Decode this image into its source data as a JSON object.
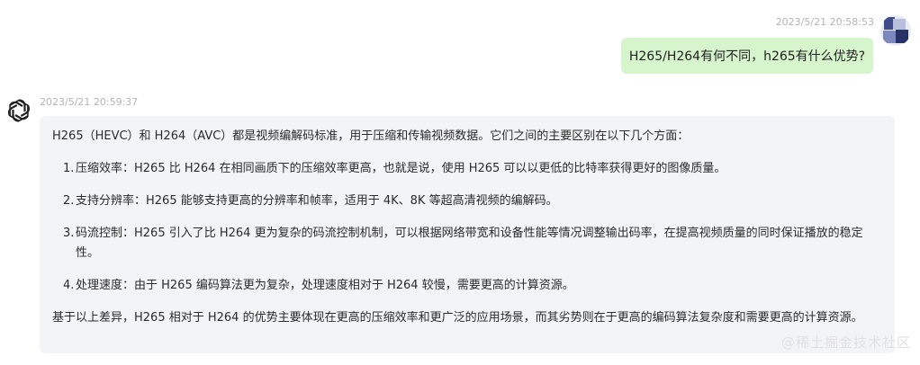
{
  "user_message": {
    "timestamp": "2023/5/21 20:58:53",
    "text": "H265/H264有何不同，h265有什么优势?"
  },
  "bot_message": {
    "timestamp": "2023/5/21 20:59:37",
    "intro": "H265（HEVC）和 H264（AVC）都是视频编解码标准，用于压缩和传输视频数据。它们之间的主要区别在以下几个方面：",
    "items": [
      {
        "number": "1.",
        "text": "压缩效率：H265 比 H264 在相同画质下的压缩效率更高，也就是说，使用 H265 可以以更低的比特率获得更好的图像质量。"
      },
      {
        "number": "2.",
        "text": "支持分辨率：H265 能够支持更高的分辨率和帧率，适用于 4K、8K 等超高清视频的编解码。"
      },
      {
        "number": "3.",
        "text": "码流控制：H265 引入了比 H264 更为复杂的码流控制机制，可以根据网络带宽和设备性能等情况调整输出码率，在提高视频质量的同时保证播放的稳定性。"
      },
      {
        "number": "4.",
        "text": "处理速度：由于 H265 编码算法更为复杂，处理速度相对于 H264 较慢，需要更高的计算资源。"
      }
    ],
    "summary": "基于以上差异，H265 相对于 H264 的优势主要体现在更高的压缩效率和更广泛的应用场景，而其劣势则在于更高的编码算法复杂度和需要更高的计算资源。"
  },
  "watermark": "@稀土掘金技术社区",
  "colors": {
    "user_bubble": "#d6f5cc",
    "bot_bubble": "#f3f4f6",
    "timestamp": "#b4b4b4"
  }
}
